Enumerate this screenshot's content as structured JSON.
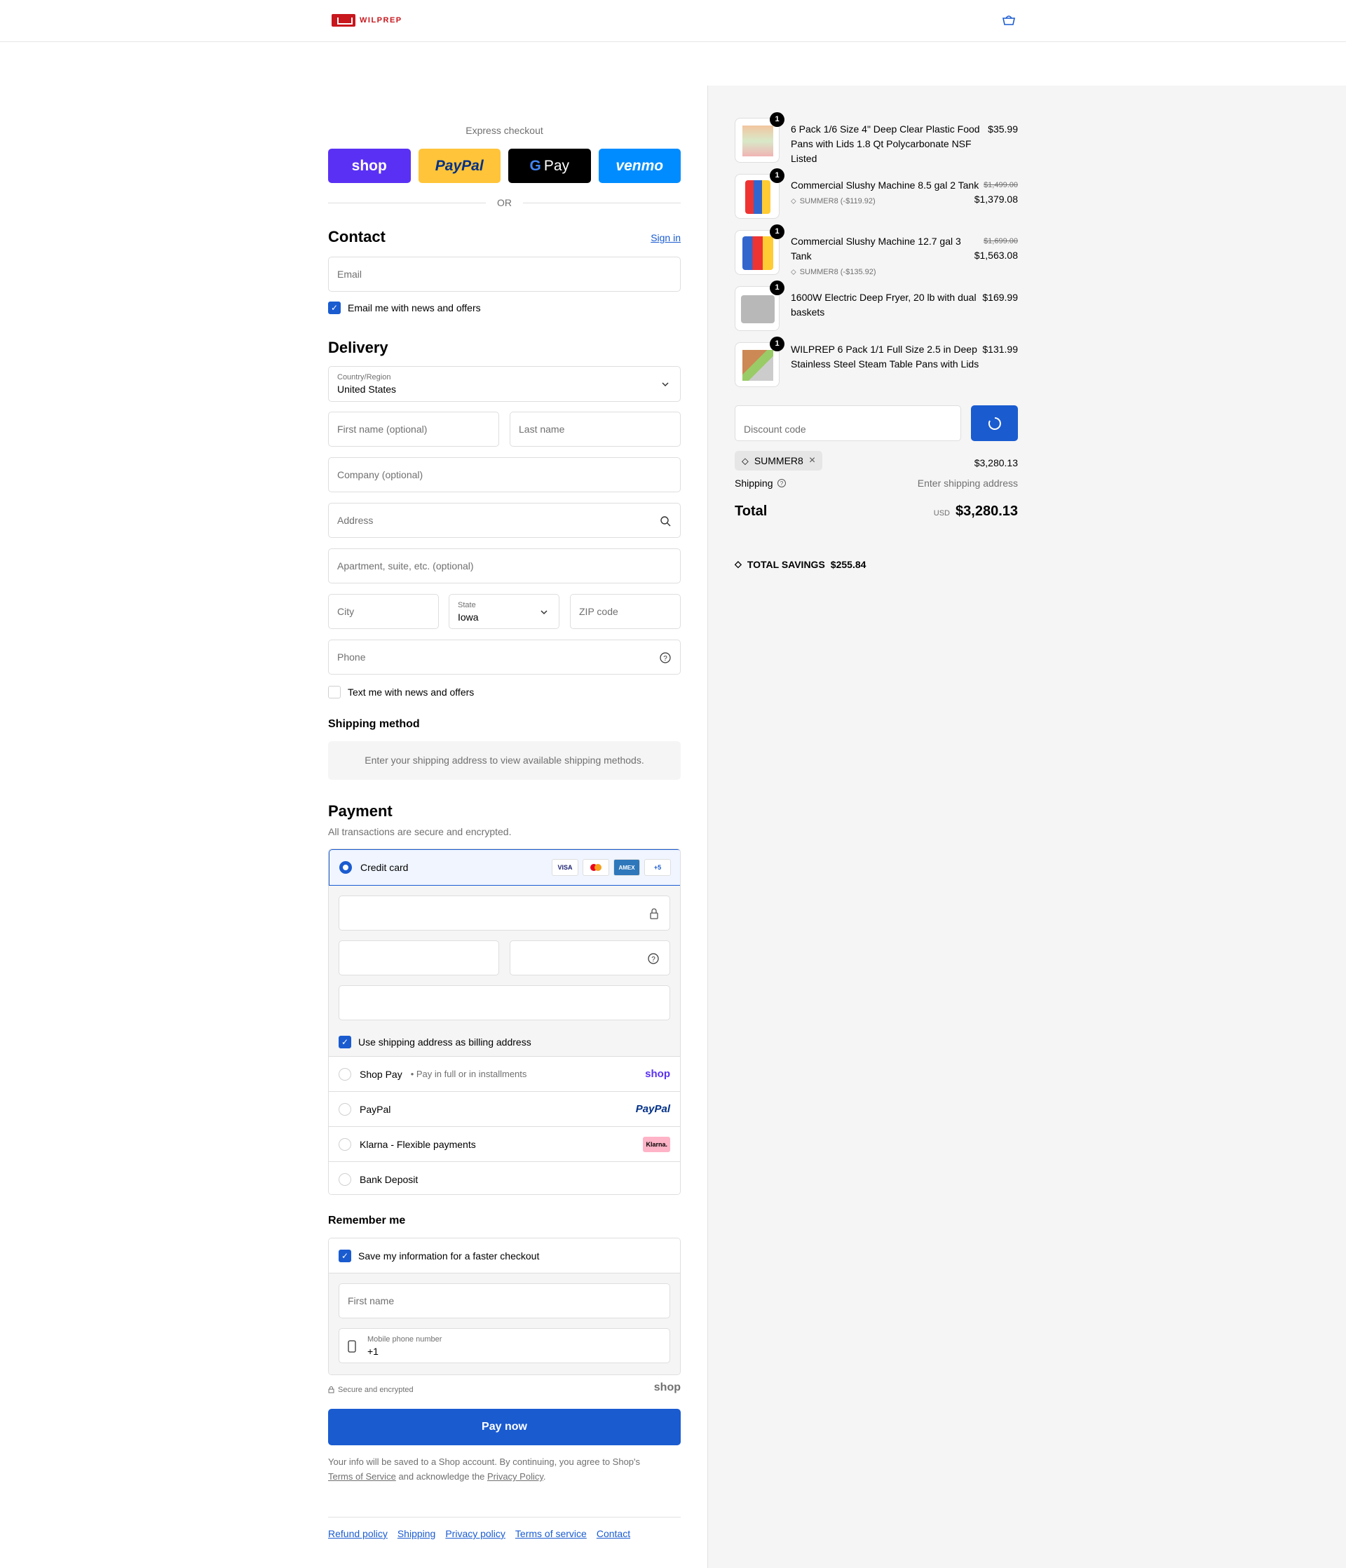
{
  "header": {
    "brand": "WILPREP",
    "cart_icon": "cart-icon"
  },
  "express": {
    "label": "Express checkout",
    "shop": "shop",
    "paypal": "PayPal",
    "gpay": "Pay",
    "venmo": "venmo",
    "or": "OR"
  },
  "contact": {
    "title": "Contact",
    "sign_in": "Sign in",
    "email_placeholder": "Email",
    "news_checkbox": "Email me with news and offers"
  },
  "delivery": {
    "title": "Delivery",
    "country_label": "Country/Region",
    "country_value": "United States",
    "first_name": "First name (optional)",
    "last_name": "Last name",
    "company": "Company (optional)",
    "address": "Address",
    "apartment": "Apartment, suite, etc. (optional)",
    "city": "City",
    "state_label": "State",
    "state_value": "Iowa",
    "zip": "ZIP code",
    "phone": "Phone",
    "text_checkbox": "Text me with news and offers"
  },
  "shipping_method": {
    "title": "Shipping method",
    "note": "Enter your shipping address to view available shipping methods."
  },
  "payment": {
    "title": "Payment",
    "subtitle": "All transactions are secure and encrypted.",
    "credit_card": "Credit card",
    "cards": [
      "VISA",
      "",
      "AMEX",
      "+5"
    ],
    "billing_checkbox": "Use shipping address as billing address",
    "shop_pay": "Shop Pay",
    "shop_pay_sub": "Pay in full or in installments",
    "shop_pay_brand": "shop",
    "paypal": "PayPal",
    "paypal_brand": "PayPal",
    "klarna": "Klarna - Flexible payments",
    "klarna_brand": "Klarna.",
    "bank": "Bank Deposit"
  },
  "remember": {
    "title": "Remember me",
    "save_checkbox": "Save my information for a faster checkout",
    "first_name": "First name",
    "mobile_label": "Mobile phone number",
    "mobile_value": "+1",
    "secure": "Secure and encrypted",
    "shop_brand": "shop"
  },
  "pay_now": "Pay now",
  "legal": {
    "text1": "Your info will be saved to a Shop account. By continuing, you agree to Shop's",
    "terms": "Terms of Service",
    "text2": "and acknowledge the",
    "privacy": "Privacy Policy",
    "dot": "."
  },
  "footer": [
    "Refund policy",
    "Shipping",
    "Privacy policy",
    "Terms of service",
    "Contact"
  ],
  "summary": {
    "items": [
      {
        "qty": "1",
        "name": "6 Pack 1/6 Size 4\" Deep Clear Plastic Food Pans with Lids 1.8 Qt Polycarbonate NSF Listed",
        "price": "$35.99",
        "original": "",
        "discount": ""
      },
      {
        "qty": "1",
        "name": "Commercial Slushy Machine 8.5 gal 2 Tank",
        "price": "$1,379.08",
        "original": "$1,499.00",
        "discount": "SUMMER8 (-$119.92)"
      },
      {
        "qty": "1",
        "name": "Commercial Slushy Machine 12.7 gal 3 Tank",
        "price": "$1,563.08",
        "original": "$1,699.00",
        "discount": "SUMMER8 (-$135.92)"
      },
      {
        "qty": "1",
        "name": "1600W Electric Deep Fryer, 20 lb with dual baskets",
        "price": "$169.99",
        "original": "",
        "discount": ""
      },
      {
        "qty": "1",
        "name": "WILPREP 6 Pack 1/1 Full Size 2.5 in Deep Stainless Steel Steam Table Pans with Lids",
        "price": "$131.99",
        "original": "",
        "discount": ""
      }
    ],
    "discount_placeholder": "Discount code",
    "code_chip": "SUMMER8",
    "subtotal": "$3,280.13",
    "shipping_label": "Shipping",
    "shipping_value": "Enter shipping address",
    "total_label": "Total",
    "currency": "USD",
    "total": "$3,280.13",
    "savings_label": "TOTAL SAVINGS",
    "savings": "$255.84"
  }
}
